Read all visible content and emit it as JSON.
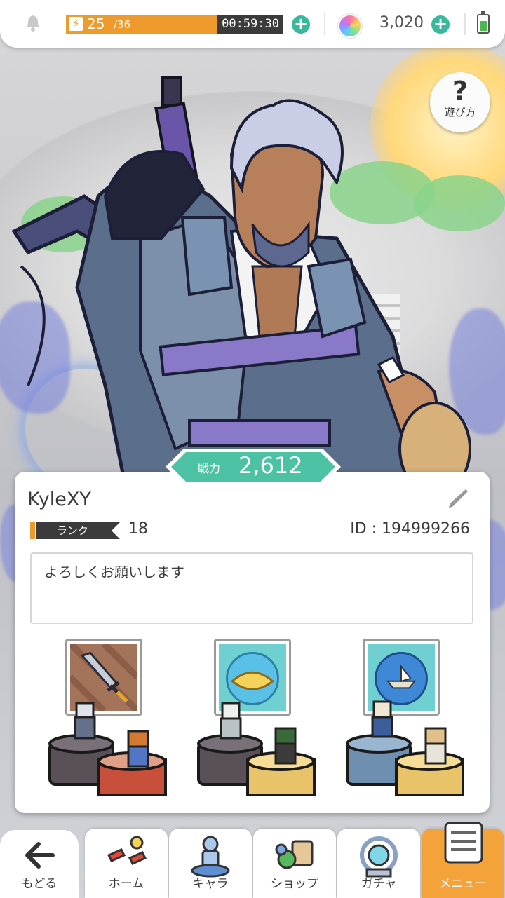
{
  "status_bar": {
    "stamina_current": "25",
    "stamina_max": "/36",
    "stamina_fraction": 0.694,
    "timer": "00:59:30",
    "gems": "3,020"
  },
  "help": {
    "label": "遊び方",
    "symbol": "?"
  },
  "profile": {
    "power_label": "戦力",
    "power_value": "2,612",
    "player_name": "KyleXY",
    "rank_label": "ランク",
    "rank_value": "18",
    "player_id": "ID : 194999266",
    "comment": "よろしくお願いします"
  },
  "nav": {
    "back": "もどる",
    "items": [
      {
        "label": "ホーム"
      },
      {
        "label": "キャラ"
      },
      {
        "label": "ショップ"
      },
      {
        "label": "ガチャ"
      },
      {
        "label": "メニュー"
      }
    ]
  },
  "colors": {
    "accent_orange": "#ef9a2c",
    "accent_teal": "#39b89c",
    "menu_active": "#f4a23a"
  },
  "icons": [
    "bell-icon",
    "lightning-icon",
    "plus-icon",
    "rainbow-gem-icon",
    "battery-icon",
    "question-icon",
    "brush-icon",
    "back-arrow-icon",
    "home-icon",
    "character-icon",
    "shop-icon",
    "gacha-icon",
    "menu-icon"
  ]
}
